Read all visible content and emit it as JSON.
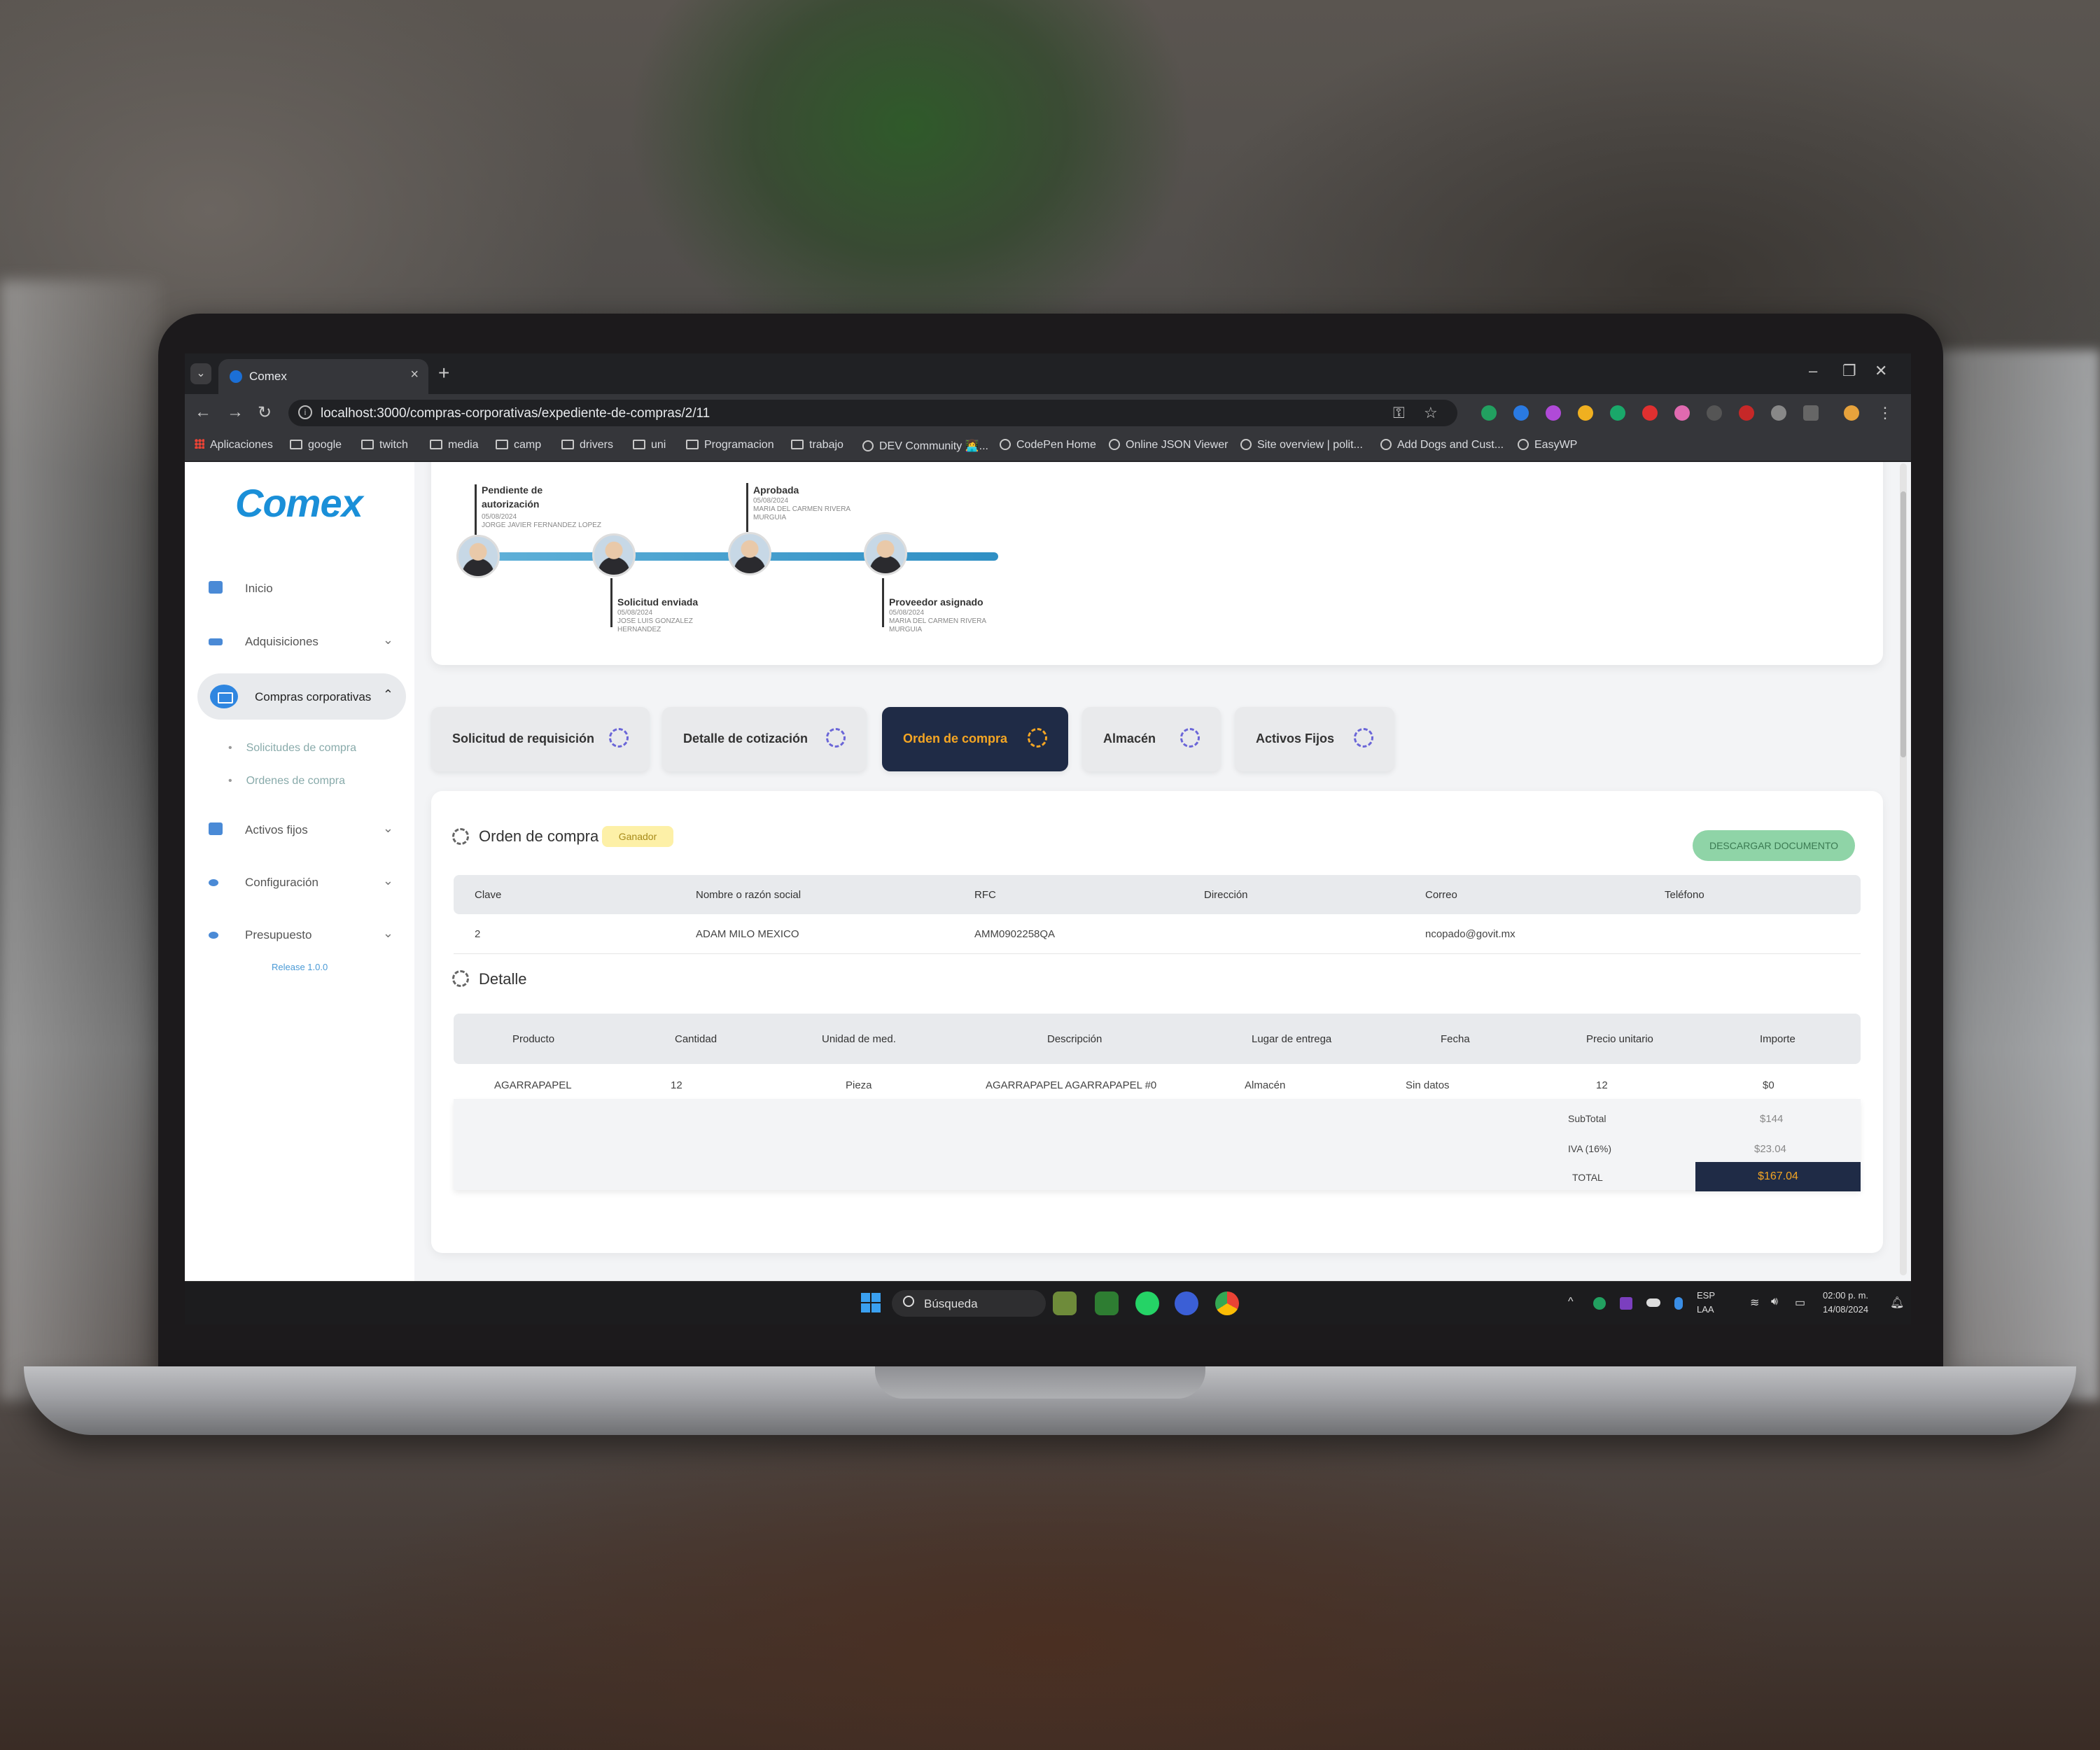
{
  "browser": {
    "tab_title": "Comex",
    "url": "localhost:3000/compras-corporativas/expediente-de-compras/2/11",
    "bookmarks": [
      "Aplicaciones",
      "google",
      "twitch",
      "media",
      "camp",
      "drivers",
      "uni",
      "Programacion",
      "trabajo",
      "DEV Community 👩‍💻...",
      "CodePen Home",
      "Online JSON Viewer",
      "Site overview | polit...",
      "Add Dogs and Cust...",
      "EasyWP"
    ]
  },
  "sidebar": {
    "logo": "Comex",
    "items": [
      {
        "label": "Inicio"
      },
      {
        "label": "Adquisiciones"
      },
      {
        "label": "Compras corporativas"
      },
      {
        "label": "Activos fijos"
      },
      {
        "label": "Configuración"
      },
      {
        "label": "Presupuesto"
      }
    ],
    "subitems": [
      "Solicitudes de compra",
      "Ordenes de compra"
    ],
    "release": "Release 1.0.0"
  },
  "timeline": [
    {
      "title": "Pendiente de autorización",
      "date": "05/08/2024",
      "person": "JORGE JAVIER FERNANDEZ LOPEZ"
    },
    {
      "title": "Solicitud enviada",
      "date": "05/08/2024",
      "person": "JOSE LUIS GONZALEZ HERNANDEZ"
    },
    {
      "title": "Aprobada",
      "date": "05/08/2024",
      "person": "MARIA DEL CARMEN RIVERA MURGUIA"
    },
    {
      "title": "Proveedor asignado",
      "date": "05/08/2024",
      "person": "MARIA DEL CARMEN RIVERA MURGUIA"
    }
  ],
  "steps": [
    {
      "label": "Solicitud de requisición"
    },
    {
      "label": "Detalle de cotización"
    },
    {
      "label": "Orden de compra",
      "active": true
    },
    {
      "label": "Almacén"
    },
    {
      "label": "Activos Fijos"
    }
  ],
  "order": {
    "title": "Orden de compra",
    "badge": "Ganador",
    "download_label": "DESCARGAR DOCUMENTO",
    "supplier_headers": [
      "Clave",
      "Nombre o razón social",
      "RFC",
      "Dirección",
      "Correo",
      "Teléfono"
    ],
    "supplier_row": [
      "2",
      "ADAM MILO MEXICO",
      "AMM0902258QA",
      "",
      "ncopado@govit.mx",
      ""
    ],
    "detail_title": "Detalle",
    "detail_headers": [
      "Producto",
      "Cantidad",
      "Unidad de med.",
      "Descripción",
      "Lugar de entrega",
      "Fecha",
      "Precio unitario",
      "Importe"
    ],
    "detail_row": [
      "AGARRAPAPEL",
      "12",
      "Pieza",
      "AGARRAPAPEL AGARRAPAPEL #0",
      "Almacén",
      "Sin datos",
      "12",
      "$0"
    ],
    "subtotal_label": "SubTotal",
    "subtotal": "$144",
    "iva_label": "IVA (16%)",
    "iva": "$23.04",
    "total_label": "TOTAL",
    "total": "$167.04"
  },
  "taskbar": {
    "search": "Búsqueda",
    "lang": "ESP",
    "lang2": "LAA",
    "time": "02:00 p. m.",
    "date": "14/08/2024"
  }
}
